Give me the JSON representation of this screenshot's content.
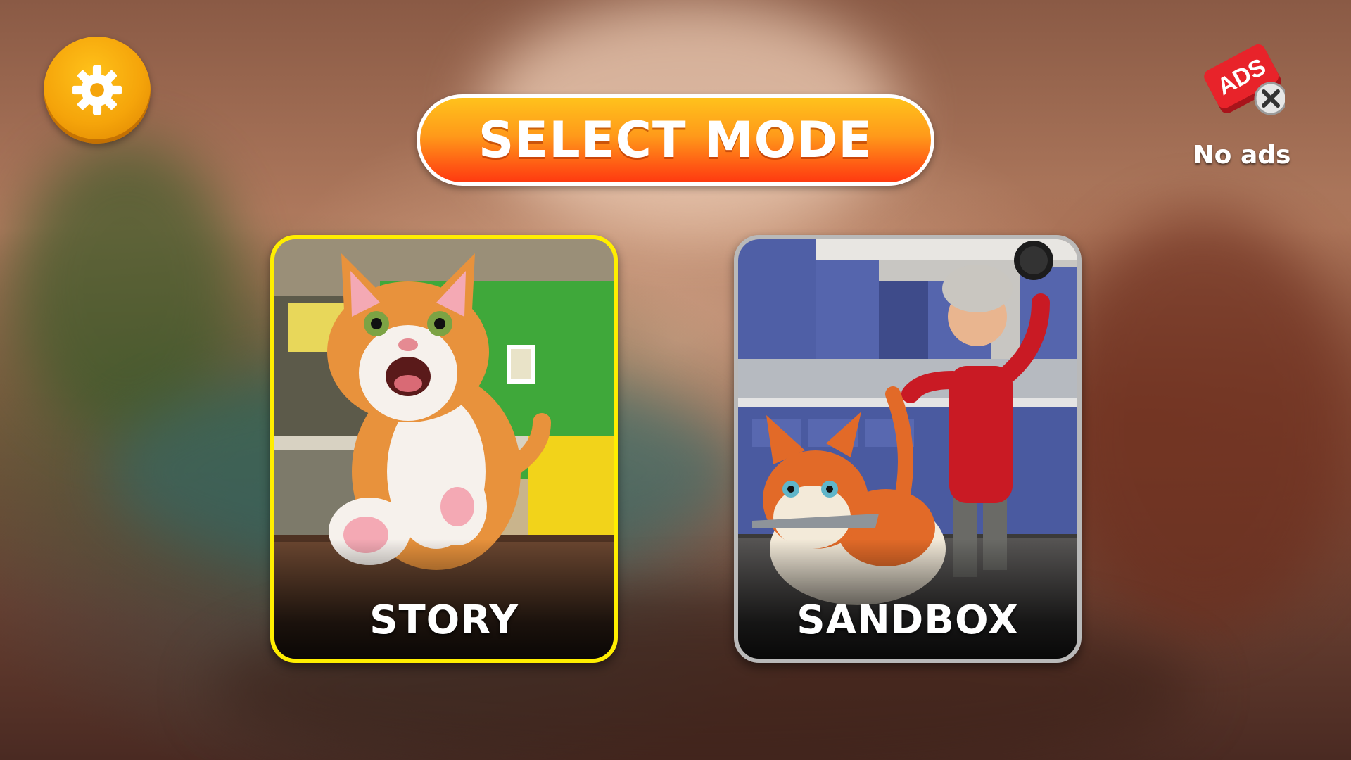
{
  "title": "SELECT MODE",
  "settings": {
    "icon": "gear-icon"
  },
  "no_ads": {
    "icon": "no-ads-icon",
    "badge_text": "ADS",
    "label": "No ads"
  },
  "modes": [
    {
      "label": "STORY",
      "selected": true
    },
    {
      "label": "SANDBOX",
      "selected": false
    }
  ],
  "colors": {
    "title_gradient_top": "#ffc21c",
    "title_gradient_bottom": "#ff3a10",
    "selected_border": "#ffee00",
    "unselected_border": "#b9b9b9",
    "settings_button": "#f5a40a",
    "ads_badge": "#e8232a"
  }
}
